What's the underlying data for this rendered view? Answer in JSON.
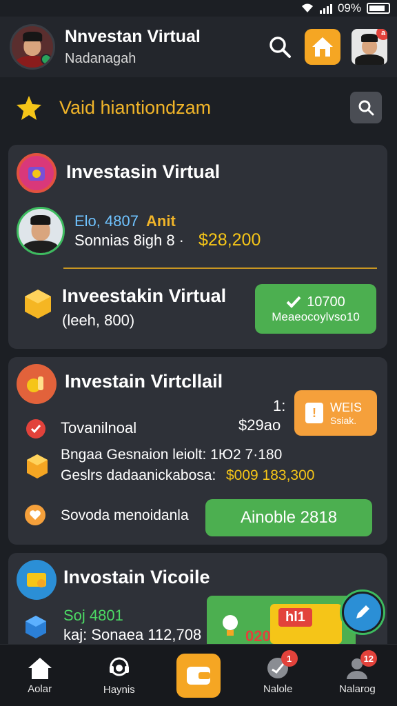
{
  "status_bar": {
    "battery": "09%"
  },
  "header": {
    "title": "Nnvestan Virtual",
    "subtitle": "Nadanagah",
    "badge": "a"
  },
  "banner": {
    "title": "Vaid hiantiondzam"
  },
  "card1": {
    "title": "Investasin Virtual",
    "user_id": "Elo, 4807",
    "user_tag": "Anit",
    "row_label": "Sonnias  8igh 8 ·",
    "row_amount": "$28,200",
    "product_title": "Inveestakin Virtual",
    "product_sub": "(leeh, 800)",
    "button_line1": "10700",
    "button_line2": "Meaeocoylvso10"
  },
  "card2": {
    "title": "Investain Virtcllail",
    "side_num": "1:",
    "amount": "$29ao",
    "check_label": "Tovanilnoal",
    "button_line1": "WEIS",
    "button_line2": "Ssiak.",
    "line1": "Bngaa Gesnaion leiolt: 1Ю2 7·180",
    "line2_label": "Geslrs dadaanickabosa:",
    "line2_amount": "$009 183,300",
    "bottom_label": "Sovoda menoidanla",
    "green_button": "Ainoble 2818"
  },
  "card3": {
    "title": "Invostain Vicoile",
    "line1": "Soj 4801",
    "line2": "kaj: Sonaea  112,708",
    "promo_text": "hl1",
    "promo_num": "020"
  },
  "nav": [
    {
      "label": "Aolar",
      "badge": ""
    },
    {
      "label": "Haynis",
      "badge": ""
    },
    {
      "label": "",
      "badge": ""
    },
    {
      "label": "Nalole",
      "badge": "1"
    },
    {
      "label": "Nalarog",
      "badge": "12"
    }
  ],
  "colors": {
    "accent": "#f5a623",
    "green": "#4caf50",
    "card": "#2e3138",
    "background": "#1c1f24"
  }
}
